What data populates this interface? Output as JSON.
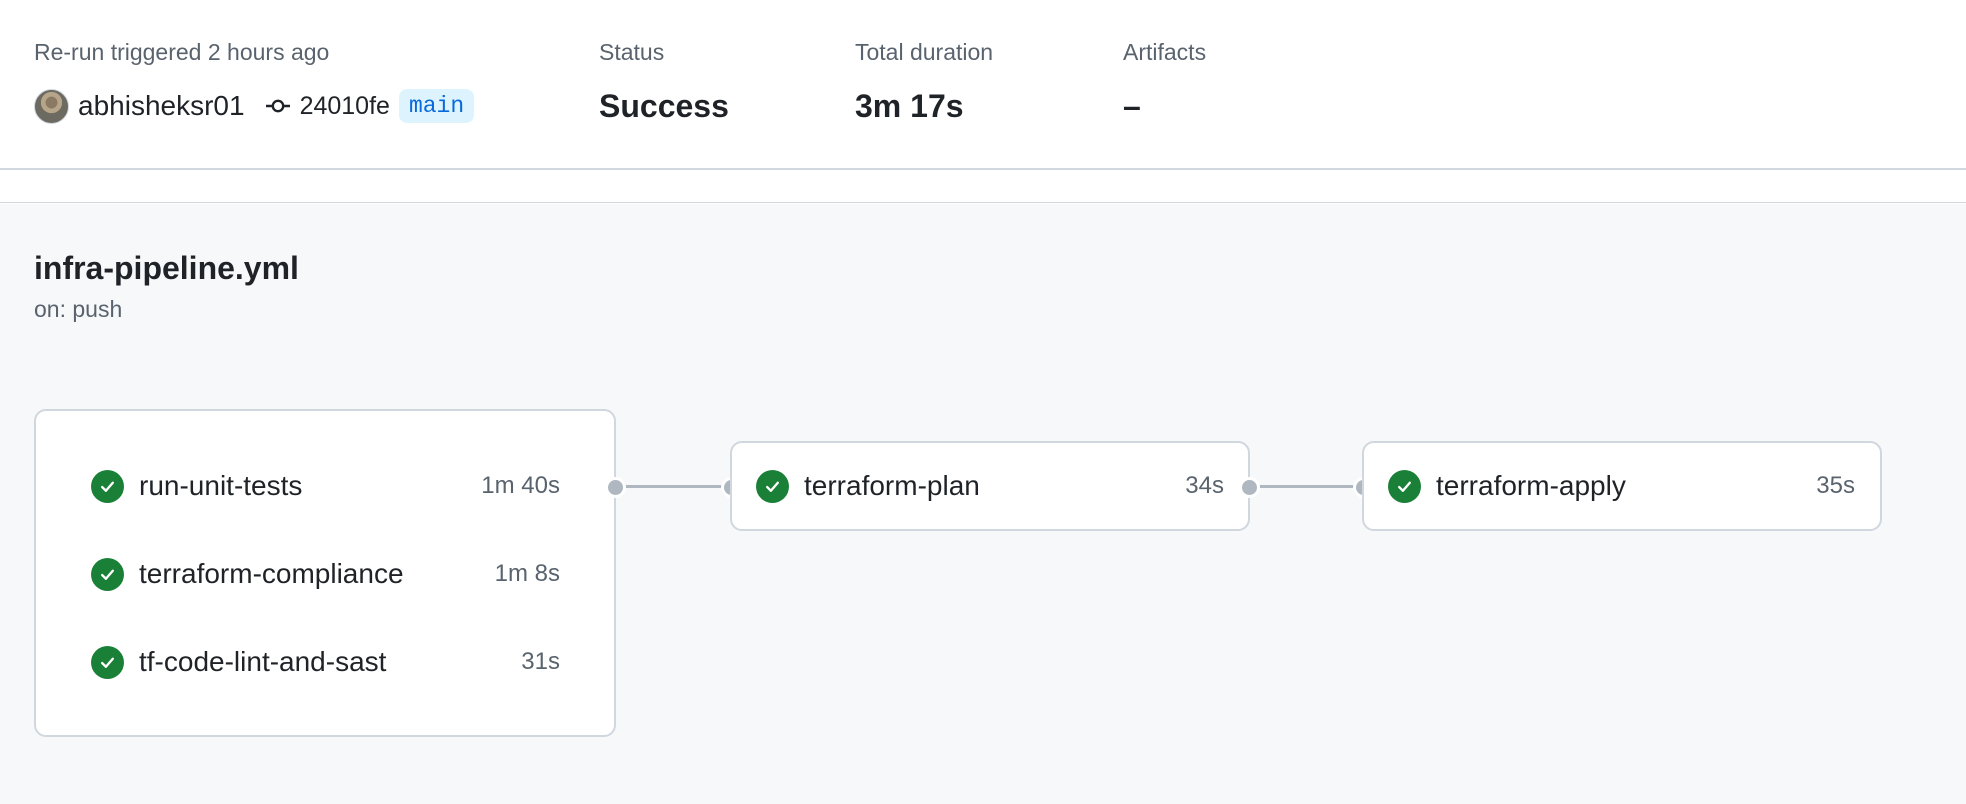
{
  "summary": {
    "trigger_label": "Re-run triggered 2 hours ago",
    "username": "abhisheksr01",
    "commit_sha": "24010fe",
    "branch": "main",
    "status_label": "Status",
    "status_value": "Success",
    "duration_label": "Total duration",
    "duration_value": "3m 17s",
    "artifacts_label": "Artifacts",
    "artifacts_value": "–"
  },
  "workflow": {
    "file": "infra-pipeline.yml",
    "trigger": "on: push",
    "group_jobs": [
      {
        "name": "run-unit-tests",
        "duration": "1m 40s",
        "status": "success"
      },
      {
        "name": "terraform-compliance",
        "duration": "1m 8s",
        "status": "success"
      },
      {
        "name": "tf-code-lint-and-sast",
        "duration": "31s",
        "status": "success"
      }
    ],
    "plan_job": {
      "name": "terraform-plan",
      "duration": "34s",
      "status": "success"
    },
    "apply_job": {
      "name": "terraform-apply",
      "duration": "35s",
      "status": "success"
    }
  },
  "colors": {
    "success": "#1a7f37",
    "branch_badge_bg": "#ddf4ff",
    "branch_badge_text": "#0969da",
    "connector": "#afb8c1"
  },
  "icons": {
    "commit": "git-commit-icon",
    "job_status": "check-circle-icon",
    "avatar": "user-avatar"
  }
}
